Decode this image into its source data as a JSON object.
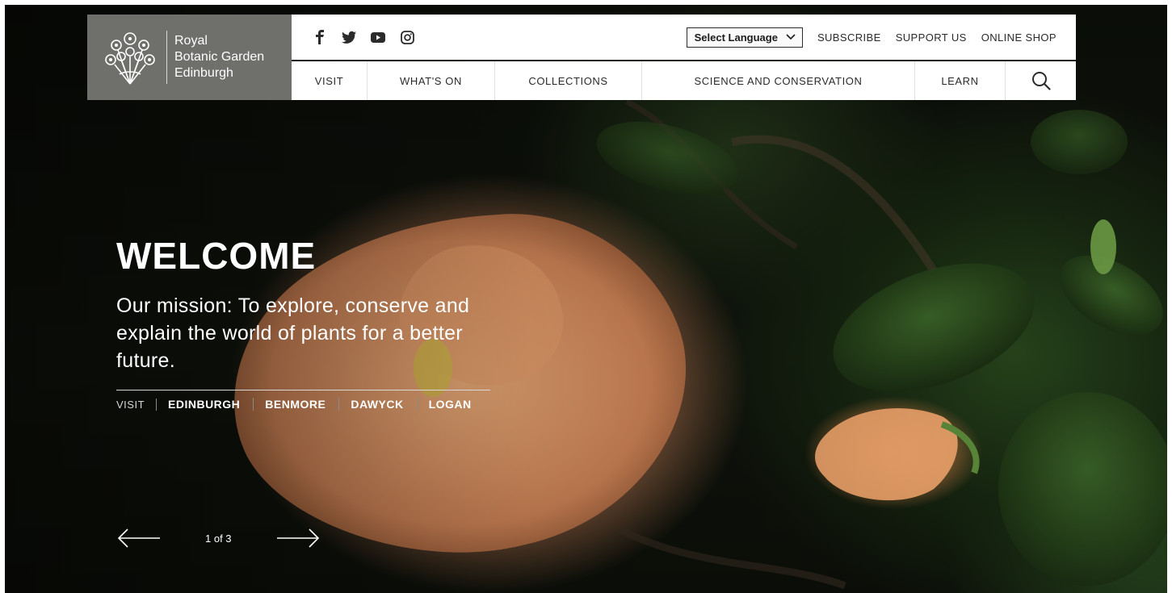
{
  "logo": {
    "line1": "Royal",
    "line2": "Botanic Garden",
    "line3": "Edinburgh",
    "icon": "flower-bouquet-icon"
  },
  "social": [
    {
      "name": "facebook",
      "glyph": "f"
    },
    {
      "name": "twitter",
      "glyph": ""
    },
    {
      "name": "youtube",
      "glyph": ""
    },
    {
      "name": "instagram",
      "glyph": ""
    }
  ],
  "topbar": {
    "language": "Select Language",
    "links": [
      "SUBSCRIBE",
      "SUPPORT US",
      "ONLINE SHOP"
    ]
  },
  "nav": {
    "items": [
      "VISIT",
      "WHAT'S ON",
      "COLLECTIONS",
      "SCIENCE AND CONSERVATION",
      "LEARN"
    ],
    "search_icon": "search-icon"
  },
  "hero": {
    "title": "WELCOME",
    "subtitle": "Our mission: To explore, conserve and explain the world of plants for a better future.",
    "visit_label": "VISIT",
    "visit_links": [
      "EDINBURGH",
      "BENMORE",
      "DAWYCK",
      "LOGAN"
    ],
    "counter": "1 of 3"
  },
  "colors": {
    "logo_bg": "#6f6f6b",
    "text_dark": "#2b2b2b",
    "hero_text": "#ffffff"
  }
}
